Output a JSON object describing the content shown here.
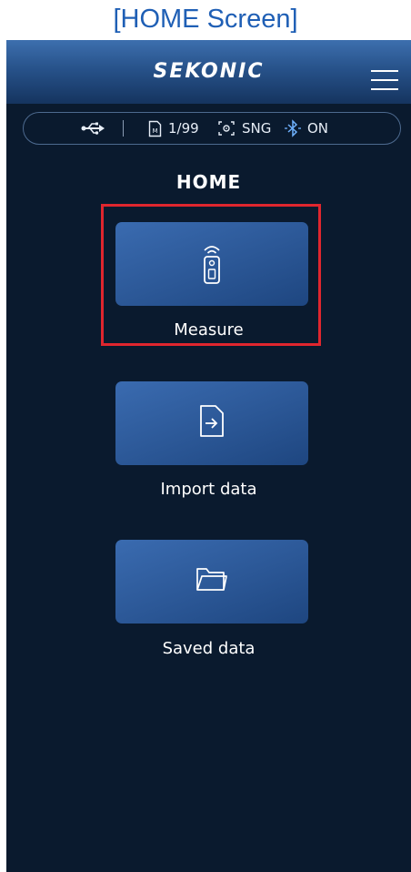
{
  "caption": "[HOME Screen]",
  "header": {
    "brand": "SEKONIC",
    "menu_icon": "hamburger-menu-icon"
  },
  "status_bar": {
    "usb_icon": "usb-icon",
    "memory_icon": "memory-card-icon",
    "memory_count": "1/99",
    "mode_icon": "single-mode-icon",
    "mode": "SNG",
    "bluetooth_icon": "bluetooth-icon",
    "bluetooth": "ON"
  },
  "page_title": "HOME",
  "menu_items": [
    {
      "label": "Measure",
      "icon": "meter-device-icon"
    },
    {
      "label": "Import data",
      "icon": "import-file-icon"
    },
    {
      "label": "Saved data",
      "icon": "folder-icon"
    }
  ],
  "colors": {
    "background": "#0a1a2e",
    "card": "#2b5796",
    "highlight": "#e0262e",
    "caption": "#1f5fb5"
  }
}
